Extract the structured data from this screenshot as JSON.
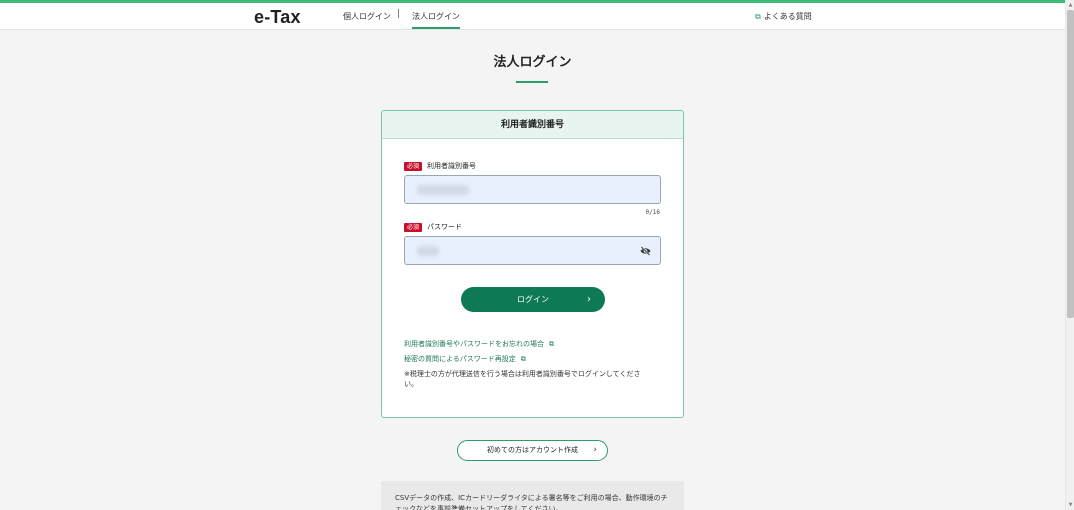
{
  "header": {
    "logo": "e-Tax",
    "nav_personal": "個人ログイン",
    "nav_separator": "|",
    "nav_corporate": "法人ログイン",
    "faq": "よくある質問",
    "faq_icon": "external-link-icon"
  },
  "page": {
    "title": "法人ログイン"
  },
  "card": {
    "heading": "利用者識別番号",
    "required_badge": "必須",
    "user_id_label": "利用者識別番号",
    "user_id_value": "",
    "user_id_counter": "0/16",
    "password_label": "パスワード",
    "password_value": "",
    "password_toggle_icon": "eye-slash-icon",
    "login_button": "ログイン",
    "login_chevron": "›",
    "link_forgot": "利用者識別番号やパスワードをお忘れの場合",
    "link_reset": "秘密の質問によるパスワード再設定",
    "note": "※税理士の方が代理送信を行う場合は利用者識別番号でログインしてください。"
  },
  "account": {
    "create_button": "初めての方はアカウント作成",
    "chevron": "›"
  },
  "info": {
    "text": "CSVデータの作成、ICカードリーダライタによる署名等をご利用の場合、動作環境のチェックなどを事前準備セットアップをしてください。"
  },
  "colors": {
    "brand_green": "#0e7a55",
    "accent_green": "#2a9d6a",
    "required_red": "#c8102e",
    "card_header_bg": "#e7f4ef"
  }
}
